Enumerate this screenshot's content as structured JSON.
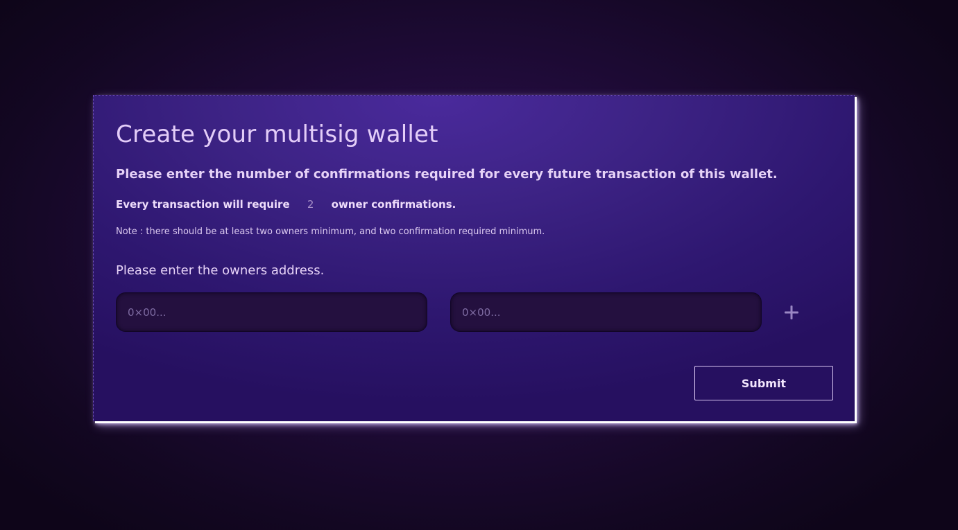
{
  "form": {
    "title": "Create your multisig wallet",
    "subtitle": "Please enter the number of confirmations required for every future transaction of this wallet.",
    "requirement": {
      "prefix": "Every transaction will require",
      "value": "2",
      "suffix": "owner confirmations."
    },
    "note": "Note : there should be at least two owners minimum, and two confirmation required minimum.",
    "owners_heading": "Please enter the owners address.",
    "owner_inputs": [
      {
        "placeholder": "0×00..."
      },
      {
        "placeholder": "0×00..."
      }
    ],
    "add_owner_icon": "plus-icon",
    "submit_label": "Submit"
  },
  "colors": {
    "panel": "#3d2385",
    "background": "#1f0b38",
    "input_bg": "#24103f",
    "text": "#e6d2f7"
  }
}
